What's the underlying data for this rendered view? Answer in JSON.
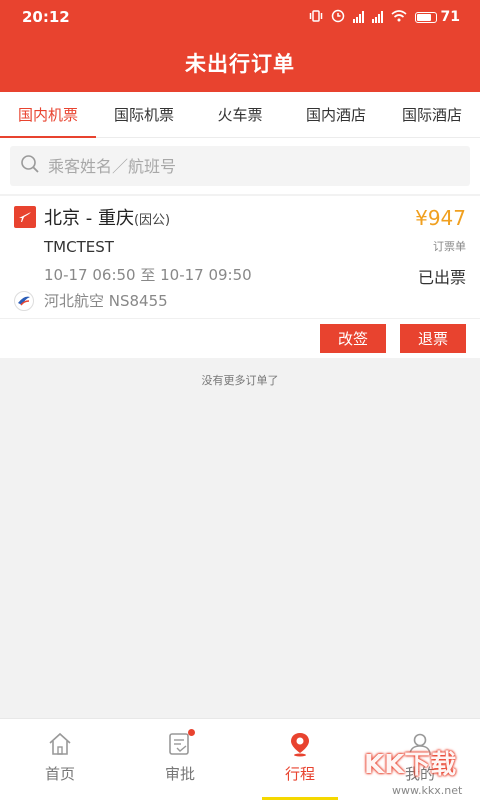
{
  "status_bar": {
    "time": "20:12",
    "battery": "71"
  },
  "header": {
    "title": "未出行订单"
  },
  "tabs": [
    {
      "label": "国内机票",
      "active": true
    },
    {
      "label": "国际机票",
      "active": false
    },
    {
      "label": "火车票",
      "active": false
    },
    {
      "label": "国内酒店",
      "active": false
    },
    {
      "label": "国际酒店",
      "active": false
    }
  ],
  "search": {
    "placeholder": "乘客姓名／航班号"
  },
  "order": {
    "route": "北京 - 重庆",
    "cabin": "(因公)",
    "price": "¥947",
    "price_sub": "订票单",
    "pnr": "TMCTEST",
    "time": "10-17 06:50 至 10-17 09:50",
    "status": "已出票",
    "airline": "河北航空 NS8455",
    "buttons": {
      "change": "改签",
      "refund": "退票"
    }
  },
  "list_end_text": "没有更多订单了",
  "bottom_nav": [
    {
      "label": "首页",
      "icon": "home-icon",
      "active": false
    },
    {
      "label": "审批",
      "icon": "approval-icon",
      "active": false
    },
    {
      "label": "行程",
      "icon": "location-pin-icon",
      "active": true
    },
    {
      "label": "我的",
      "icon": "user-icon",
      "active": false
    }
  ],
  "watermark": {
    "text": "KK下载",
    "url": "www.kkx.net"
  },
  "colors": {
    "brand": "#e8432f",
    "price": "#f0a020",
    "nav_indicator": "#f5d800"
  }
}
